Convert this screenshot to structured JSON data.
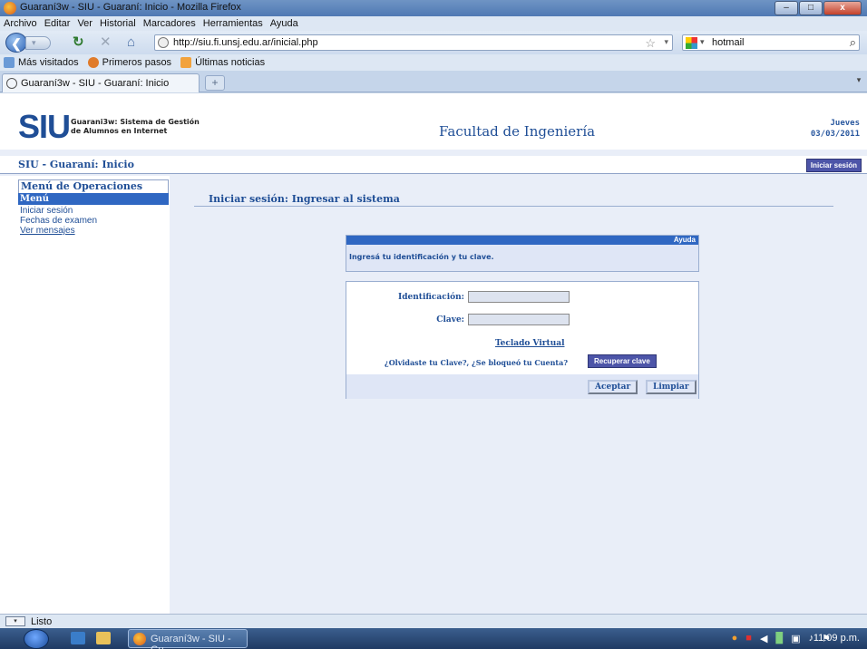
{
  "window": {
    "title": "Guaraní3w - SIU - Guaraní: Inicio - Mozilla Firefox",
    "min": "–",
    "max": "□",
    "close": "x"
  },
  "menubar": [
    "Archivo",
    "Editar",
    "Ver",
    "Historial",
    "Marcadores",
    "Herramientas",
    "Ayuda"
  ],
  "nav": {
    "back_glyph": "❮",
    "fwd_glyph": "▾",
    "reload_glyph": "↻",
    "stop_glyph": "✕",
    "home_glyph": "⌂",
    "url": "http://siu.fi.unsj.edu.ar/inicial.php",
    "star_glyph": "☆",
    "search_value": "hotmail",
    "search_glyph": "⌕"
  },
  "bookmarks": [
    {
      "label": "Más visitados",
      "color": "#6a9ad6"
    },
    {
      "label": "Primeros pasos",
      "color": "#e07b2a"
    },
    {
      "label": "Últimas noticias",
      "color": "#f2a23c"
    }
  ],
  "tab": {
    "label": "Guaraní3w - SIU - Guaraní: Inicio",
    "new_tab_glyph": "+",
    "scroll_glyph": "▾"
  },
  "header": {
    "logo": "SIU",
    "subtitle_line1": "Guarani3w: Sistema de Gestión",
    "subtitle_line2": "de Alumnos en Internet",
    "faculty": "Facultad de Ingeniería",
    "day": "Jueves",
    "date": "03/03/2011"
  },
  "crumb": {
    "title": "SIU - Guaraní: Inicio",
    "login_button": "Iniciar sesión"
  },
  "sidebar": {
    "heading": "Menú de Operaciones",
    "menu_label": "Menú",
    "items": [
      "Iniciar sesión",
      "Fechas de examen",
      "Ver mensajes"
    ]
  },
  "main": {
    "title": "Iniciar sesión: Ingresar al sistema",
    "help_label": "Ayuda",
    "help_text": "Ingresá tu identificación y tu clave.",
    "id_label": "Identificación:",
    "pwd_label": "Clave:",
    "virtual_kb": "Teclado Virtual",
    "forgot_text": "¿Olvidaste tu Clave?, ¿Se bloqueó tu Cuenta?",
    "recover_button": "Recuperar clave",
    "accept_button": "Aceptar",
    "clear_button": "Limpiar"
  },
  "status": {
    "text": "Listo"
  },
  "taskbar": {
    "task_label": "Guaraní3w - SIU - Gu...",
    "clock": "11:09 p.m."
  }
}
